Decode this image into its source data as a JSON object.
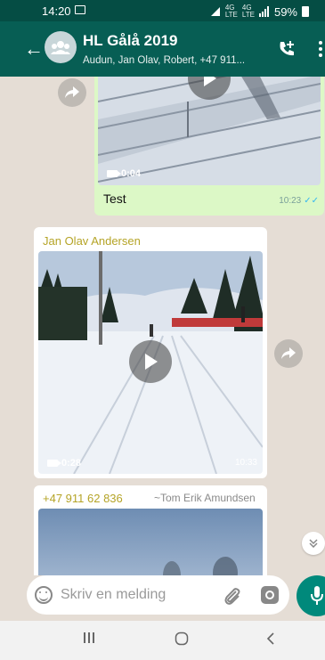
{
  "status": {
    "time": "14:20",
    "battery": "59%"
  },
  "header": {
    "title": "HL Gålå 2019",
    "subtitle": "Audun, Jan Olav, Robert, +47 911..."
  },
  "messages": {
    "outgoing": {
      "duration": "0:04",
      "caption": "Test",
      "time": "10:23"
    },
    "incoming1": {
      "sender": "Jan Olav Andersen",
      "duration": "0:28",
      "time": "10:33"
    },
    "incoming2": {
      "sender": "+47 911 62 836",
      "sender_name": "~Tom Erik Amundsen"
    }
  },
  "composer": {
    "placeholder": "Skriv en melding"
  },
  "colors": {
    "header": "#075e54",
    "statusbar": "#054d44",
    "outgoing_bubble": "#dcf8c6",
    "accent": "#00897b",
    "sender": "#b5a427"
  }
}
